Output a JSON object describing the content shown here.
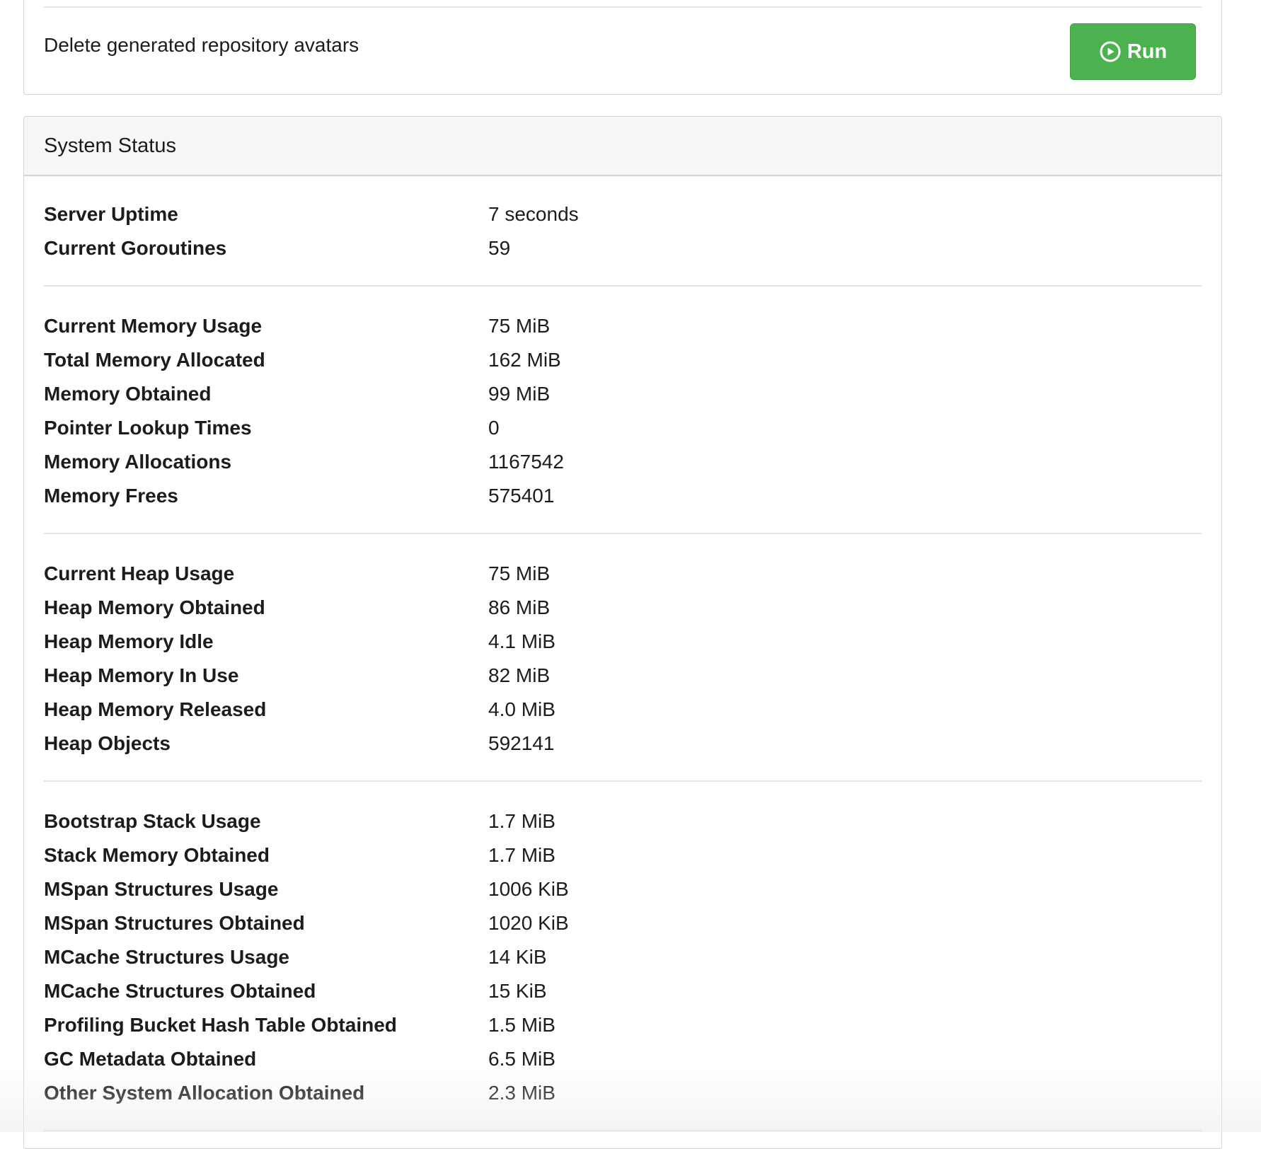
{
  "task": {
    "label": "Delete generated repository avatars",
    "run_label": "Run",
    "button_color": "#4cb24f",
    "icon": "play-circle-icon"
  },
  "system_status": {
    "title": "System Status",
    "groups": [
      {
        "rows": [
          {
            "key": "Server Uptime",
            "value": "7 seconds"
          },
          {
            "key": "Current Goroutines",
            "value": "59"
          }
        ]
      },
      {
        "rows": [
          {
            "key": "Current Memory Usage",
            "value": "75 MiB"
          },
          {
            "key": "Total Memory Allocated",
            "value": "162 MiB"
          },
          {
            "key": "Memory Obtained",
            "value": "99 MiB"
          },
          {
            "key": "Pointer Lookup Times",
            "value": "0"
          },
          {
            "key": "Memory Allocations",
            "value": "1167542"
          },
          {
            "key": "Memory Frees",
            "value": "575401"
          }
        ]
      },
      {
        "rows": [
          {
            "key": "Current Heap Usage",
            "value": "75 MiB"
          },
          {
            "key": "Heap Memory Obtained",
            "value": "86 MiB"
          },
          {
            "key": "Heap Memory Idle",
            "value": "4.1 MiB"
          },
          {
            "key": "Heap Memory In Use",
            "value": "82 MiB"
          },
          {
            "key": "Heap Memory Released",
            "value": "4.0 MiB"
          },
          {
            "key": "Heap Objects",
            "value": "592141"
          }
        ]
      },
      {
        "rows": [
          {
            "key": "Bootstrap Stack Usage",
            "value": "1.7 MiB"
          },
          {
            "key": "Stack Memory Obtained",
            "value": "1.7 MiB"
          },
          {
            "key": "MSpan Structures Usage",
            "value": "1006 KiB"
          },
          {
            "key": "MSpan Structures Obtained",
            "value": "1020 KiB"
          },
          {
            "key": "MCache Structures Usage",
            "value": "14 KiB"
          },
          {
            "key": "MCache Structures Obtained",
            "value": "15 KiB"
          },
          {
            "key": "Profiling Bucket Hash Table Obtained",
            "value": "1.5 MiB"
          },
          {
            "key": "GC Metadata Obtained",
            "value": "6.5 MiB"
          },
          {
            "key": "Other System Allocation Obtained",
            "value": "2.3 MiB"
          }
        ]
      }
    ]
  }
}
